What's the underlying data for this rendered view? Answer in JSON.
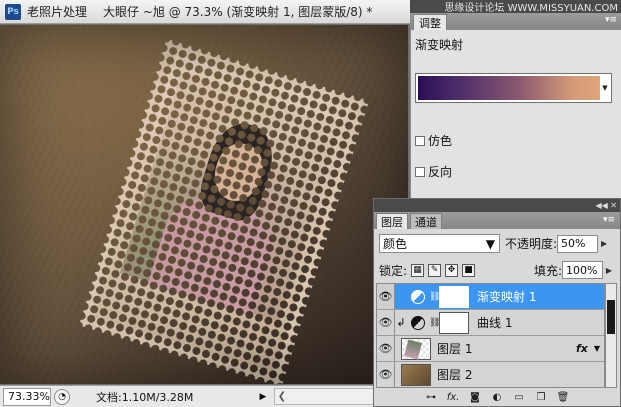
{
  "window": {
    "app_title": "老照片处理",
    "doc_title": "大眼仔 ~旭 @ 73.3% (渐变映射 1, 图层蒙版/8) *",
    "zoom": "73.33%",
    "doc_info": "文档:1.10M/3.28M"
  },
  "watermark": "思缘设计论坛 WWW.MISSYUAN.COM",
  "adjustments": {
    "tab": "调整",
    "heading": "渐变映射",
    "gradient_colors": [
      "#2a0d54",
      "#8a5870",
      "#e0a57a"
    ],
    "dither_label": "仿色",
    "reverse_label": "反向",
    "dither_checked": false,
    "reverse_checked": false
  },
  "layers": {
    "tabs": [
      "图层",
      "通道"
    ],
    "blend_mode": "颜色",
    "opacity_label": "不透明度:",
    "opacity_value": "50%",
    "lock_label": "锁定:",
    "fill_label": "填充:",
    "fill_value": "100%",
    "items": [
      {
        "name": "渐变映射 1",
        "selected": true
      },
      {
        "name": "曲线 1",
        "selected": false
      },
      {
        "name": "图层 1",
        "selected": false,
        "fx": "fx"
      },
      {
        "name": "图层 2",
        "selected": false
      }
    ]
  }
}
